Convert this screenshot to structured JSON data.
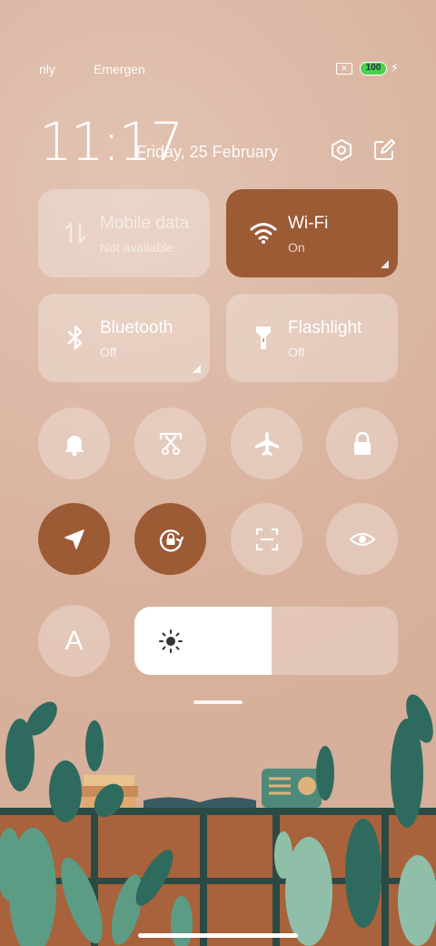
{
  "status_bar": {
    "carrier_1": "nly",
    "carrier_2": "Emergen",
    "battery": "100"
  },
  "header": {
    "time": "11:17",
    "date": "Friday, 25 February",
    "icons": [
      "settings-icon",
      "edit-icon"
    ]
  },
  "tiles": [
    {
      "title": "Mobile data",
      "subtitle": "Not available",
      "icon": "mobile-data-icon"
    },
    {
      "title": "Wi-Fi",
      "subtitle": "On",
      "icon": "wifi-icon"
    },
    {
      "title": "Bluetooth",
      "subtitle": "Off",
      "icon": "bluetooth-icon"
    },
    {
      "title": "Flashlight",
      "subtitle": "Off",
      "icon": "flashlight-icon"
    }
  ],
  "toggles_row1": [
    "bell-icon",
    "screenshot-icon",
    "airplane-icon",
    "lock-icon"
  ],
  "toggles_row2": [
    "location-icon",
    "rotation-lock-icon",
    "scanner-icon",
    "eye-icon"
  ],
  "font_button": "A",
  "brightness": {
    "level": 0.52,
    "icon": "sun-icon"
  },
  "colors": {
    "accent": "#9c5a35",
    "background": "#dcb9a7"
  }
}
